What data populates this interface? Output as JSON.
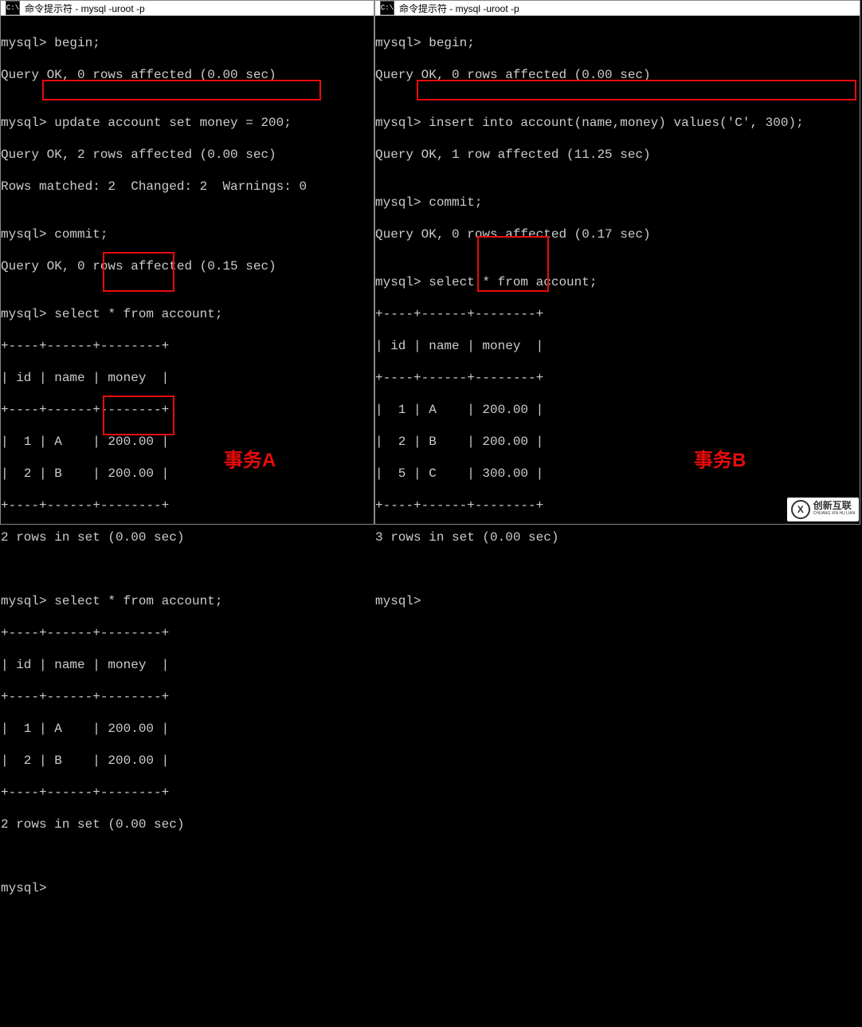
{
  "left": {
    "title": "命令提示符 - mysql  -uroot -p",
    "lines": {
      "l0": "mysql> begin;",
      "l1": "Query OK, 0 rows affected (0.00 sec)",
      "l2": "",
      "l3": "mysql> update account set money = 200;",
      "l4": "Query OK, 2 rows affected (0.00 sec)",
      "l5": "Rows matched: 2  Changed: 2  Warnings: 0",
      "l6": "",
      "l7": "mysql> commit;",
      "l8": "Query OK, 0 rows affected (0.15 sec)",
      "l9": "",
      "l10": "mysql> select * from account;"
    },
    "table1": {
      "border": "+----+------+--------+",
      "header": "| id | name | money  |",
      "r1": "|  1 | A    | 200.00 |",
      "r2": "|  2 | B    | 200.00 |",
      "rows_text": "2 rows in set (0.00 sec)"
    },
    "lines2": {
      "s0": "mysql> select * from account;"
    },
    "table2": {
      "border": "+----+------+--------+",
      "header": "| id | name | money  |",
      "r1": "|  1 | A    | 200.00 |",
      "r2": "|  2 | B    | 200.00 |",
      "rows_text": "2 rows in set (0.00 sec)"
    },
    "prompt": "mysql>",
    "label": "事务A"
  },
  "right": {
    "title": "命令提示符 - mysql  -uroot -p",
    "lines": {
      "l0": "mysql> begin;",
      "l1": "Query OK, 0 rows affected (0.00 sec)",
      "l2": "",
      "l3": "mysql> insert into account(name,money) values('C', 300);",
      "l4": "Query OK, 1 row affected (11.25 sec)",
      "l5": "",
      "l6": "mysql> commit;",
      "l7": "Query OK, 0 rows affected (0.17 sec)",
      "l8": "",
      "l9": "mysql> select * from account;"
    },
    "table1": {
      "border": "+----+------+--------+",
      "header": "| id | name | money  |",
      "r1": "|  1 | A    | 200.00 |",
      "r2": "|  2 | B    | 200.00 |",
      "r3": "|  5 | C    | 300.00 |",
      "rows_text": "3 rows in set (0.00 sec)"
    },
    "prompt": "mysql>",
    "label": "事务B"
  },
  "icon_text": "C:\\",
  "watermark": {
    "main": "创新互联",
    "sub": "CHUANG XIN HU LIAN",
    "mark": "X"
  }
}
